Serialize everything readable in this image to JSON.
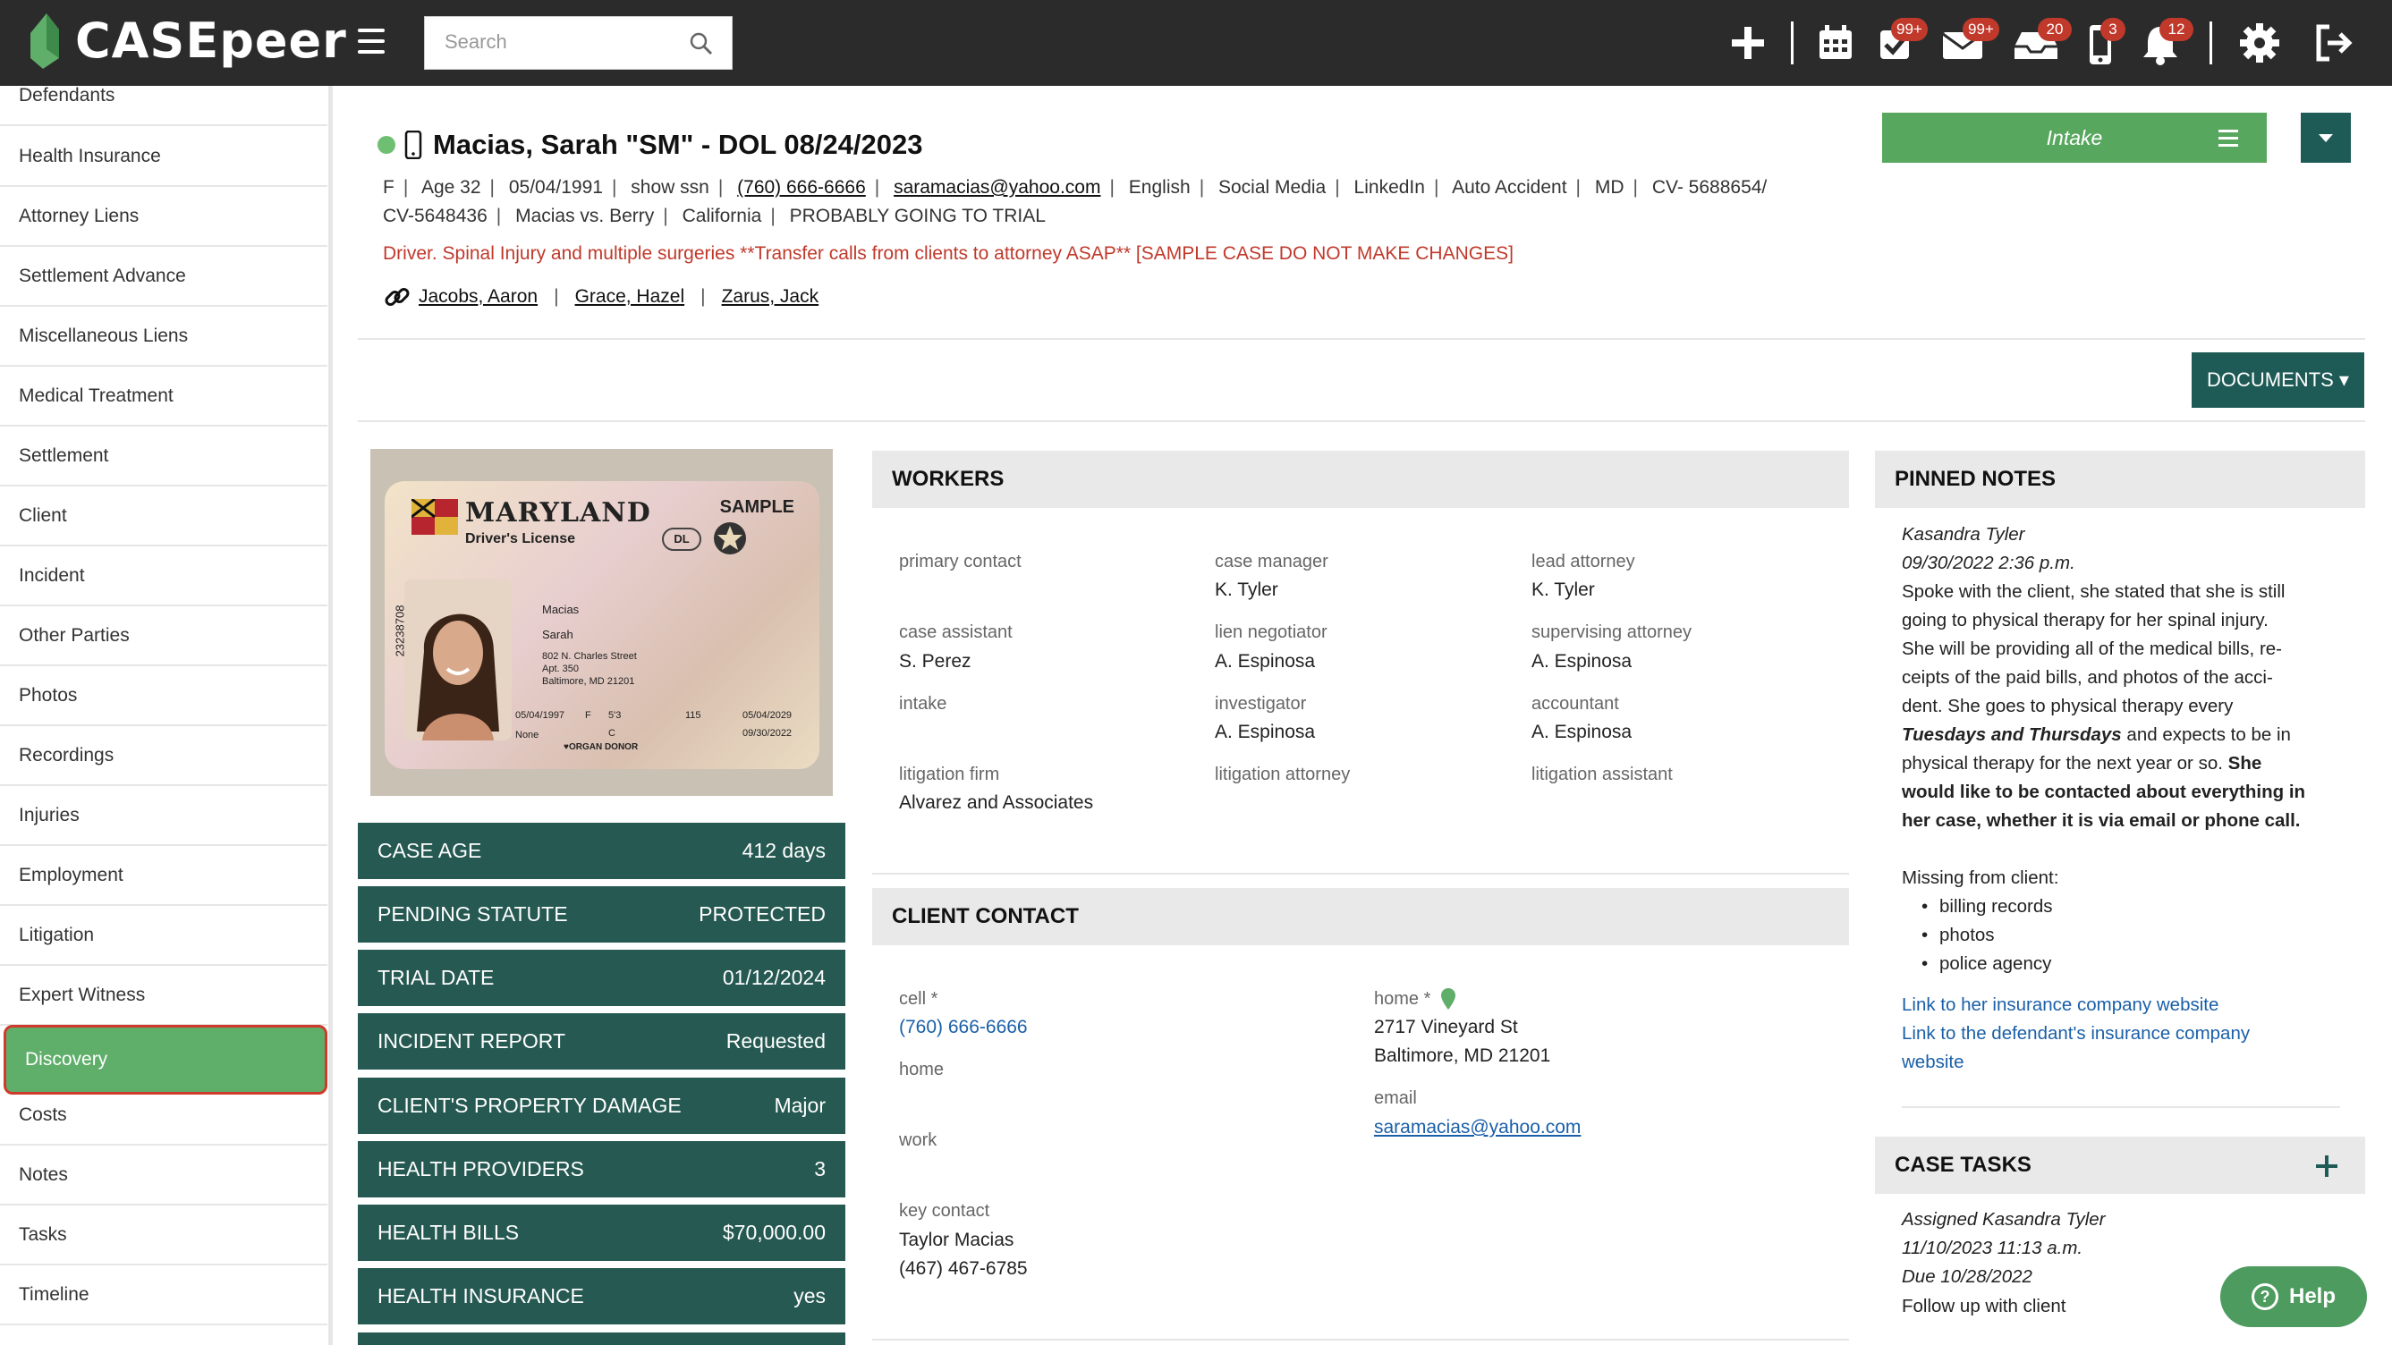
{
  "app": {
    "logo_text": "CASEpeer",
    "search_placeholder": "Search",
    "badges": {
      "tasks": "99+",
      "mail": "99+",
      "inbox": "20",
      "phone": "3",
      "notifications": "12"
    },
    "colors": {
      "topbar": "#2b2b2b",
      "brand_green": "#58a75e",
      "teal": "#255952",
      "badge_red": "#c0392b",
      "link_blue": "#1a5fa8"
    }
  },
  "sidebar": {
    "items": [
      {
        "label": "Defendants"
      },
      {
        "label": "Health Insurance"
      },
      {
        "label": "Attorney Liens"
      },
      {
        "label": "Settlement Advance"
      },
      {
        "label": "Miscellaneous Liens"
      },
      {
        "label": "Medical Treatment"
      },
      {
        "label": "Settlement"
      },
      {
        "label": "Client"
      },
      {
        "label": "Incident"
      },
      {
        "label": "Other Parties"
      },
      {
        "label": "Photos"
      },
      {
        "label": "Recordings"
      },
      {
        "label": "Injuries"
      },
      {
        "label": "Employment"
      },
      {
        "label": "Litigation"
      },
      {
        "label": "Expert Witness"
      },
      {
        "label": "Discovery",
        "active": true
      },
      {
        "label": "Costs"
      },
      {
        "label": "Notes"
      },
      {
        "label": "Tasks"
      },
      {
        "label": "Timeline"
      }
    ]
  },
  "case": {
    "title": "Macias, Sarah \"SM\" - DOL 08/24/2023",
    "sex": "F",
    "age": "Age 32",
    "dob": "05/04/1991",
    "show_ssn": "show ssn",
    "phone": "(760) 666-6666",
    "email": "saramacias@yahoo.com",
    "language": "English",
    "source": "Social Media",
    "source_detail": "LinkedIn",
    "case_type": "Auto Accident",
    "state": "MD",
    "case_no_1": "CV- 5688654/",
    "case_no_2": "CV-5648436",
    "caption": "Macias vs. Berry",
    "venue": "California",
    "outlook": "PROBABLY GOING TO TRIAL",
    "description": "Driver. Spinal Injury and multiple surgeries **Transfer calls from clients to attorney ASAP** [SAMPLE CASE DO NOT MAKE CHANGES]",
    "related_people": [
      "Jacobs, Aaron",
      "Grace, Hazel",
      "Zarus, Jack"
    ],
    "status_button": "Intake",
    "documents_button": "DOCUMENTS ▾"
  },
  "license": {
    "state": "MARYLAND",
    "type": "Driver's License",
    "sample": "SAMPLE",
    "dl": "DL",
    "family_name": "Macias",
    "given_name": "Sarah",
    "address_1": "802 N. Charles Street",
    "address_2": "Apt. 350",
    "address_3": "Baltimore, MD 21201",
    "dob": "05/04/1997",
    "sex": "F",
    "height": "5'3",
    "weight": "115",
    "expiry": "05/04/2029",
    "class": "C",
    "restrictions": "None",
    "issue_date": "09/30/2022",
    "organ_donor": "♥ORGAN DONOR",
    "side_number": "23238708"
  },
  "stats": [
    {
      "label": "CASE AGE",
      "value": "412 days"
    },
    {
      "label": "PENDING STATUTE",
      "value": "PROTECTED"
    },
    {
      "label": "TRIAL DATE",
      "value": "01/12/2024"
    },
    {
      "label": "INCIDENT REPORT",
      "value": "Requested"
    },
    {
      "label": "CLIENT'S PROPERTY DAMAGE",
      "value": "Major"
    },
    {
      "label": "HEALTH PROVIDERS",
      "value": "3"
    },
    {
      "label": "HEALTH BILLS",
      "value": "$70,000.00"
    },
    {
      "label": "HEALTH INSURANCE",
      "value": "yes"
    }
  ],
  "workers": {
    "heading": "WORKERS",
    "items": [
      {
        "label": "primary contact",
        "value": ""
      },
      {
        "label": "case manager",
        "value": "K. Tyler"
      },
      {
        "label": "lead attorney",
        "value": "K. Tyler"
      },
      {
        "label": "case assistant",
        "value": "S. Perez"
      },
      {
        "label": "lien negotiator",
        "value": "A. Espinosa"
      },
      {
        "label": "supervising attorney",
        "value": "A. Espinosa"
      },
      {
        "label": "intake",
        "value": ""
      },
      {
        "label": "investigator",
        "value": "A. Espinosa"
      },
      {
        "label": "accountant",
        "value": "A. Espinosa"
      },
      {
        "label": "litigation firm",
        "value": "Alvarez and Associates"
      },
      {
        "label": "litigation attorney",
        "value": ""
      },
      {
        "label": "litigation assistant",
        "value": ""
      }
    ]
  },
  "client_contact": {
    "heading": "CLIENT CONTACT",
    "cell_label": "cell *",
    "cell_value": "(760) 666-6666",
    "home_phone_label": "home",
    "work_label": "work",
    "key_contact_label": "key contact",
    "key_contact_name": "Taylor Macias",
    "key_contact_phone": "(467) 467-6785",
    "home_address_label": "home *",
    "address_1": "2717 Vineyard St",
    "address_2": "Baltimore, MD 21201",
    "email_label": "email",
    "email_value": "saramacias@yahoo.com"
  },
  "pinned_notes": {
    "heading": "PINNED NOTES",
    "author": "Kasandra Tyler",
    "timestamp": "09/30/2022 2:36 p.m.",
    "lines": [
      "Spoke with the client, she stated that she is still",
      "going to physical therapy for her spinal injury.",
      "She will be providing all of the medical bills, re-",
      "ceipts of the paid bills, and photos of the acci-",
      "dent. She goes to physical therapy every"
    ],
    "days": "Tuesdays and Thursdays",
    "line_after_days": " and expects to be in",
    "line_7_plain": "physical therapy for the next year or so. ",
    "line_7_bold": "She",
    "bold_1": "would like to be contacted about everything in",
    "bold_2": "her case, whether it is via email or phone call.",
    "missing_label": "Missing from client:",
    "missing": [
      "billing records",
      "photos",
      "police agency"
    ],
    "link_1": "Link to her insurance company website",
    "link_2a": "Link to the defendant's insurance company",
    "link_2b": "website"
  },
  "case_tasks": {
    "heading": "CASE TASKS",
    "assigned": "Assigned Kasandra Tyler",
    "timestamp": "11/10/2023 11:13 a.m.",
    "due": "Due 10/28/2022",
    "task": "Follow up with client"
  },
  "help": {
    "label": "Help"
  }
}
